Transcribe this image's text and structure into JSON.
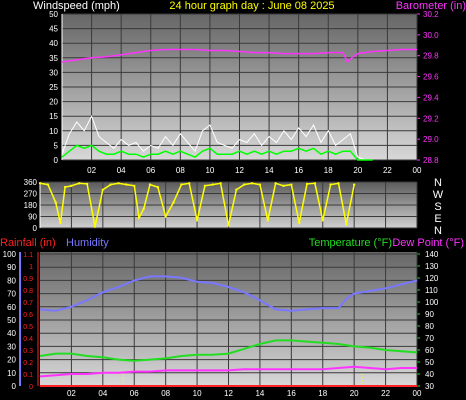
{
  "header": {
    "left_label": "Windspeed (mph)",
    "center_label": "24 hour graph day : June 08 2025",
    "right_label": "Barometer (in)"
  },
  "mid": {
    "compass_letters": [
      "N",
      "W",
      "S",
      "E",
      "N"
    ]
  },
  "bottom": {
    "rain_label": "Rainfall (in)",
    "hum_label": "Humidity",
    "temp_label": "Temperature (°F)",
    "dew_label": "Dew Point (°F)"
  },
  "colors": {
    "wind_label": "#ffffff",
    "gust": "#ffffff",
    "avg_wind": "#00ff00",
    "barometer": "#ff33ff",
    "direction": "#ffff00",
    "rain_axis": "#ff2222",
    "humidity": "#7a78ff",
    "temperature": "#22dd22",
    "dew_point": "#ff33ff",
    "temp_axis": "#22dd22"
  },
  "chart_data": [
    {
      "type": "line",
      "title": "24 hour graph day : June 08 2025",
      "x_ticks": [
        "02",
        "04",
        "06",
        "08",
        "10",
        "12",
        "14",
        "16",
        "18",
        "20",
        "22",
        "00"
      ],
      "y_left": {
        "label": "Windspeed (mph)",
        "ticks": [
          0,
          5,
          10,
          15,
          20,
          25,
          30,
          35,
          40,
          45,
          50
        ],
        "range": [
          0,
          50
        ]
      },
      "y_right": {
        "label": "Barometer (in)",
        "ticks": [
          28.8,
          29.0,
          29.2,
          29.4,
          29.6,
          29.8,
          30.0,
          30.2
        ],
        "range": [
          28.8,
          30.2
        ]
      },
      "series": [
        {
          "name": "Barometer (in)",
          "axis": "right",
          "x": [
            0,
            1,
            2,
            3,
            4,
            5,
            6,
            7,
            8,
            9,
            10,
            11,
            12,
            13,
            14,
            15,
            16,
            17,
            18,
            19,
            19.3,
            19.6,
            20,
            21,
            22,
            23,
            24
          ],
          "y": [
            29.74,
            29.76,
            29.78,
            29.79,
            29.81,
            29.83,
            29.85,
            29.86,
            29.86,
            29.86,
            29.85,
            29.85,
            29.84,
            29.83,
            29.83,
            29.82,
            29.82,
            29.82,
            29.83,
            29.83,
            29.74,
            29.78,
            29.82,
            29.84,
            29.85,
            29.86,
            29.86
          ]
        },
        {
          "name": "Gust",
          "axis": "left",
          "x": [
            0,
            0.5,
            1,
            1.5,
            2,
            2.5,
            3,
            3.5,
            4,
            4.5,
            5,
            5.5,
            6,
            6.5,
            7,
            7.5,
            8,
            8.5,
            9,
            9.5,
            10,
            10.5,
            11,
            11.5,
            12,
            12.5,
            13,
            13.5,
            14,
            14.5,
            15,
            15.5,
            16,
            16.5,
            17,
            17.5,
            18,
            18.5,
            19,
            19.5,
            20,
            20.5,
            21
          ],
          "y": [
            2,
            9,
            13,
            10,
            15,
            8,
            6,
            4,
            7,
            5,
            6,
            3,
            5,
            4,
            8,
            5,
            9,
            6,
            3,
            10,
            12,
            6,
            5,
            4,
            7,
            6,
            9,
            5,
            8,
            6,
            10,
            7,
            11,
            8,
            12,
            6,
            10,
            5,
            7,
            9,
            1,
            0,
            0
          ]
        },
        {
          "name": "Average",
          "axis": "left",
          "x": [
            0,
            0.5,
            1,
            1.5,
            2,
            2.5,
            3,
            3.5,
            4,
            4.5,
            5,
            5.5,
            6,
            6.5,
            7,
            7.5,
            8,
            8.5,
            9,
            9.5,
            10,
            10.5,
            11,
            11.5,
            12,
            12.5,
            13,
            13.5,
            14,
            14.5,
            15,
            15.5,
            16,
            16.5,
            17,
            17.5,
            18,
            18.5,
            19,
            19.5,
            20,
            20.5,
            21
          ],
          "y": [
            1,
            3,
            5,
            4,
            5,
            3,
            2,
            2,
            3,
            2,
            2,
            1,
            2,
            2,
            3,
            2,
            3,
            2,
            1,
            3,
            4,
            2,
            2,
            2,
            3,
            2,
            3,
            2,
            3,
            2,
            3,
            3,
            4,
            3,
            4,
            2,
            3,
            2,
            3,
            3,
            0,
            0,
            0
          ]
        }
      ]
    },
    {
      "type": "scatter",
      "title": "",
      "y_ticks": [
        0,
        90,
        180,
        270,
        360
      ],
      "range": [
        0,
        360
      ],
      "series": [
        {
          "name": "Wind direction",
          "x": [
            0,
            0.5,
            1,
            1.3,
            1.6,
            2,
            2.5,
            3,
            3.5,
            4,
            4.5,
            5,
            5.5,
            6,
            6.3,
            6.6,
            7,
            7.5,
            8,
            8.5,
            9,
            9.5,
            10,
            10.5,
            11,
            11.5,
            12,
            12.5,
            13,
            13.5,
            14,
            14.5,
            15,
            15.5,
            16,
            16.5,
            17,
            17.5,
            18,
            18.5,
            19,
            19.5,
            20
          ],
          "y": [
            350,
            340,
            200,
            40,
            320,
            330,
            350,
            345,
            10,
            300,
            340,
            350,
            340,
            330,
            80,
            150,
            340,
            320,
            90,
            200,
            340,
            350,
            60,
            330,
            340,
            350,
            20,
            300,
            340,
            350,
            340,
            60,
            350,
            330,
            340,
            40,
            345,
            350,
            60,
            340,
            350,
            30,
            340
          ]
        }
      ]
    },
    {
      "type": "line",
      "title": "",
      "x_ticks": [
        "02",
        "04",
        "06",
        "08",
        "10",
        "12",
        "14",
        "16",
        "18",
        "20",
        "22",
        "00"
      ],
      "y_left_humidity": {
        "label": "Humidity",
        "ticks": [
          0,
          10,
          20,
          30,
          40,
          50,
          60,
          70,
          80,
          90,
          100
        ],
        "range": [
          0,
          100
        ]
      },
      "y_left_rain": {
        "label": "Rainfall (in)",
        "ticks": [
          0,
          0.1,
          0.2,
          0.3,
          0.4,
          0.5,
          0.6,
          0.7,
          0.8,
          0.9,
          1,
          1.1
        ],
        "range": [
          0,
          1.1
        ]
      },
      "y_right": {
        "label": "Temperature (°F)",
        "ticks": [
          30,
          40,
          50,
          60,
          70,
          80,
          90,
          100,
          110,
          120,
          130,
          140
        ],
        "range": [
          30,
          140
        ]
      },
      "series": [
        {
          "name": "Humidity",
          "axis": "humidity",
          "x": [
            0,
            1,
            2,
            3,
            4,
            5,
            6,
            7,
            8,
            9,
            10,
            11,
            12,
            13,
            14,
            15,
            16,
            17,
            18,
            19,
            19.5,
            20,
            21,
            22,
            23,
            24
          ],
          "y": [
            58,
            57,
            60,
            65,
            71,
            75,
            80,
            83,
            83,
            82,
            79,
            78,
            75,
            71,
            65,
            58,
            57,
            58,
            59,
            59,
            66,
            70,
            72,
            74,
            77,
            80
          ]
        },
        {
          "name": "Temperature (°F)",
          "axis": "right",
          "x": [
            0,
            1,
            2,
            3,
            4,
            5,
            6,
            7,
            8,
            9,
            10,
            11,
            12,
            13,
            14,
            15,
            16,
            17,
            18,
            19,
            20,
            21,
            22,
            23,
            24
          ],
          "y": [
            55,
            57,
            57,
            55,
            54,
            52,
            51,
            52,
            53,
            55,
            56,
            56,
            57,
            61,
            65,
            68,
            68,
            67,
            66,
            65,
            63,
            62,
            60,
            59,
            58
          ]
        },
        {
          "name": "Dew Point (°F)",
          "axis": "right",
          "x": [
            0,
            1,
            2,
            3,
            4,
            5,
            6,
            7,
            8,
            9,
            10,
            11,
            12,
            13,
            14,
            15,
            16,
            17,
            18,
            19,
            20,
            21,
            22,
            23,
            24
          ],
          "y": [
            38,
            39,
            40,
            40,
            41,
            41,
            42,
            42,
            43,
            43,
            43,
            43,
            43,
            44,
            44,
            44,
            44,
            44,
            44,
            45,
            46,
            45,
            44,
            45,
            45
          ]
        },
        {
          "name": "Rainfall (in)",
          "axis": "rain",
          "x": [
            0,
            24
          ],
          "y": [
            0,
            0
          ]
        }
      ]
    }
  ]
}
